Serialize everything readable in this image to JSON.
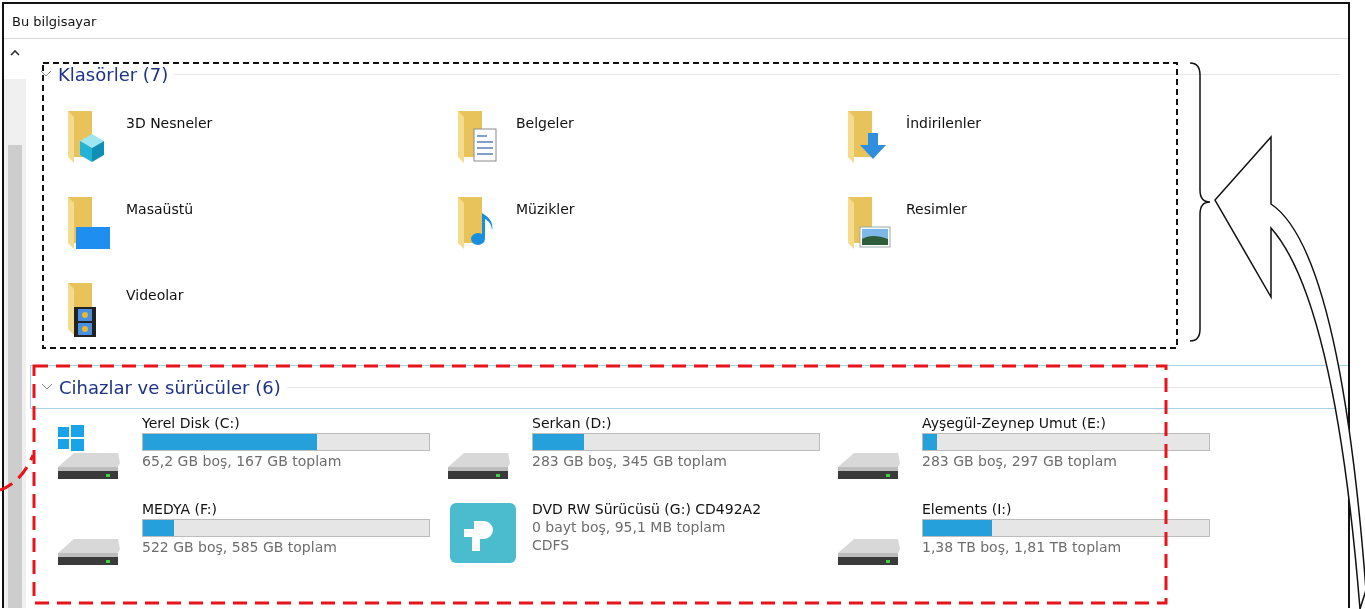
{
  "window": {
    "title": "Bu bilgisayar"
  },
  "folders_section": {
    "title": "Klasörler (7)",
    "expanded": true,
    "items": [
      {
        "name": "3D Nesneler",
        "kind": "objects3d"
      },
      {
        "name": "Belgeler",
        "kind": "documents"
      },
      {
        "name": "İndirilenler",
        "kind": "downloads"
      },
      {
        "name": "Masaüstü",
        "kind": "desktop"
      },
      {
        "name": "Müzikler",
        "kind": "music"
      },
      {
        "name": "Resimler",
        "kind": "pictures"
      },
      {
        "name": "Videolar",
        "kind": "videos"
      }
    ]
  },
  "drives_section": {
    "title": "Cihazlar ve sürücüler (6)",
    "expanded": true,
    "items": [
      {
        "name": "Yerel Disk (C:)",
        "kind": "system",
        "level": 0.61,
        "detail": "65,2 GB boş, 167 GB toplam"
      },
      {
        "name": "Serkan (D:)",
        "kind": "drive",
        "level": 0.18,
        "detail": "283 GB boş, 345 GB toplam"
      },
      {
        "name": "Ayşegül-Zeynep Umut (E:)",
        "kind": "drive",
        "level": 0.05,
        "detail": "283 GB boş, 297 GB toplam"
      },
      {
        "name": "MEDYA (F:)",
        "kind": "drive",
        "level": 0.11,
        "detail": "522 GB boş, 585 GB toplam"
      },
      {
        "name": "DVD RW Sürücüsü (G:) CD492A2",
        "kind": "optical",
        "detail": "0 bayt boş, 95,1 MB toplam",
        "filesystem": "CDFS"
      },
      {
        "name": "Elements (I:)",
        "kind": "drive",
        "level": 0.24,
        "detail": "1,38 TB boş, 1,81 TB toplam"
      }
    ]
  }
}
